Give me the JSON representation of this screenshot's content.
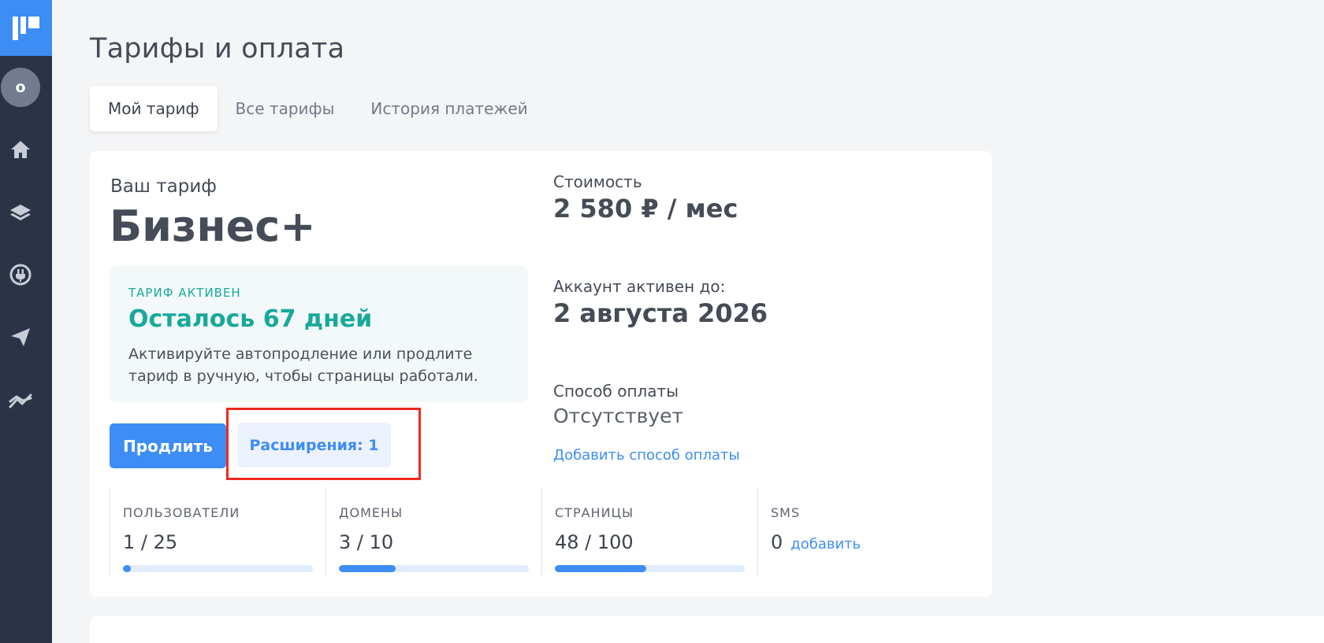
{
  "page": {
    "title": "Тарифы и оплата"
  },
  "sidebar": {
    "avatar_letter": "o"
  },
  "tabs": [
    {
      "label": "Мой тариф",
      "active": true
    },
    {
      "label": "Все тарифы",
      "active": false
    },
    {
      "label": "История платежей",
      "active": false
    }
  ],
  "plan": {
    "label": "Ваш тариф",
    "name": "Бизнес+",
    "status_tag": "ТАРИФ АКТИВЕН",
    "days_left": "Осталось 67 дней",
    "description": "Активируйте автопродление или продлите тариф в ручную, чтобы страницы работали.",
    "renew_button": "Продлить",
    "extensions_button": "Расширения: 1"
  },
  "billing": {
    "cost_label": "Стоимость",
    "cost_value": "2 580 ₽ / мес",
    "active_until_label": "Аккаунт активен до:",
    "active_until_value": "2 августа 2026",
    "payment_method_label": "Способ оплаты",
    "payment_method_value": "Отсутствует",
    "add_payment_link": "Добавить способ оплаты"
  },
  "stats": [
    {
      "label": "ПОЛЬЗОВАТЕЛИ",
      "value": "1 / 25",
      "used": 1,
      "total": 25
    },
    {
      "label": "ДОМЕНЫ",
      "value": "3 / 10",
      "used": 3,
      "total": 10
    },
    {
      "label": "СТРАНИЦЫ",
      "value": "48 / 100",
      "used": 48,
      "total": 100
    },
    {
      "label": "SMS",
      "value": "0",
      "add_link": "добавить"
    }
  ],
  "colors": {
    "accent": "#3d8df5",
    "sidebar": "#2b3347",
    "success": "#17a99b",
    "highlight": "#ee2a1f"
  }
}
